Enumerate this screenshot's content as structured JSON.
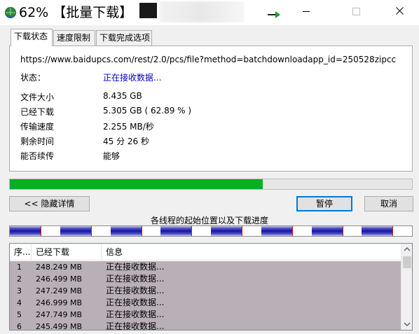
{
  "window": {
    "title": "62% 【批量下载】",
    "accent_color": "#0078d7",
    "progress_color": "#06b025"
  },
  "tabs": [
    {
      "label": "下载状态",
      "active": true
    },
    {
      "label": "速度限制",
      "active": false
    },
    {
      "label": "下载完成选项",
      "active": false
    }
  ],
  "info": {
    "url": "https://www.baidupcs.com/rest/2.0/pcs/file?method=batchdownloadapp_id=250528zipcc",
    "status_label": "状态：",
    "status_value": "正在接收数据...",
    "rows": [
      {
        "label": "文件大小",
        "value": "8.435  GB"
      },
      {
        "label": "已经下载",
        "value": "5.305  GB  ( 62.89 % )"
      },
      {
        "label": "传输速度",
        "value": "2.255  MB/秒"
      },
      {
        "label": "剩余时间",
        "value": "45 分 26 秒"
      },
      {
        "label": "能否续传",
        "value": "能够"
      }
    ]
  },
  "progress": {
    "percent": 62.89
  },
  "buttons": {
    "hide_details": "<< 隐藏详情",
    "pause": "暂停",
    "cancel": "取消"
  },
  "segments": {
    "caption": "各线程的起始位置以及下载进度",
    "count": 8,
    "fill_fraction": 0.62
  },
  "list": {
    "columns": [
      "序...",
      "已经下载",
      "信息"
    ],
    "rows": [
      {
        "index": "1",
        "downloaded": "248.249  MB",
        "info": "正在接收数据..."
      },
      {
        "index": "2",
        "downloaded": "246.499  MB",
        "info": "正在接收数据..."
      },
      {
        "index": "3",
        "downloaded": "247.249  MB",
        "info": "正在接收数据..."
      },
      {
        "index": "4",
        "downloaded": "246.999  MB",
        "info": "正在接收数据..."
      },
      {
        "index": "5",
        "downloaded": "247.749  MB",
        "info": "正在接收数据..."
      },
      {
        "index": "6",
        "downloaded": "245.499  MB",
        "info": "正在接收数据..."
      }
    ]
  }
}
